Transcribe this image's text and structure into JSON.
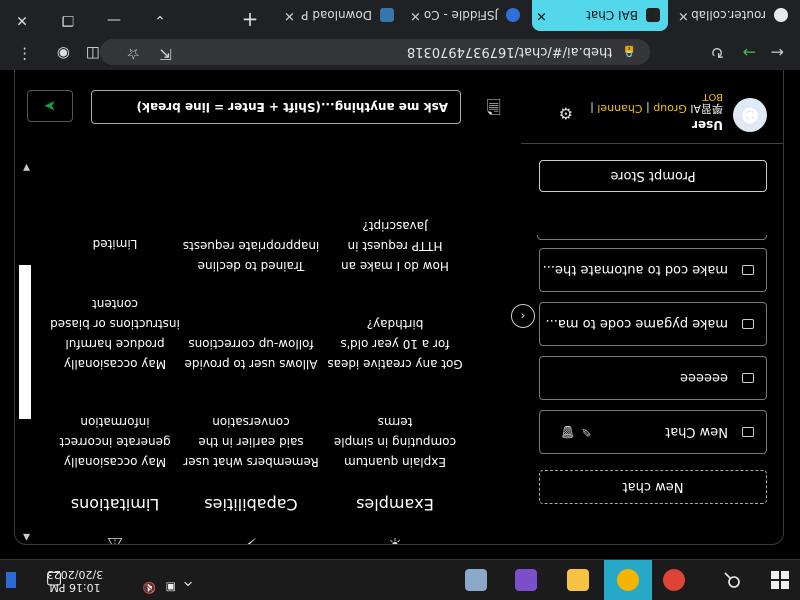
{
  "taskbar": {
    "clock_time": "10:16 PM",
    "clock_date": "3/20/2023",
    "tray_expand": "^",
    "apps": [
      {
        "name": "chrome-icon",
        "color": "#db4437"
      },
      {
        "name": "browser-icon",
        "color": "#f4b400"
      },
      {
        "name": "file-explorer-icon",
        "color": "#f6c243"
      },
      {
        "name": "visual-studio-icon",
        "color": "#7b4fc9"
      },
      {
        "name": "app-icon",
        "color": "#8aa9c8"
      }
    ]
  },
  "sidebar": {
    "new_chat": "New chat",
    "chats": [
      {
        "label": "New Chat",
        "active": true
      },
      {
        "label": "eeeeee"
      },
      {
        "label": "make pygame code to ma..."
      },
      {
        "label": "make cod to automate the..."
      }
    ],
    "prompt_store": "Prompt Store",
    "user": {
      "name": "User",
      "chinese": "學習AI",
      "group": "Group",
      "separator": "|",
      "channel": "Channel",
      "bot": "BOT"
    }
  },
  "main": {
    "columns": [
      {
        "icon": "sun-icon",
        "title": "Examples",
        "items": [
          "Explain quantum computing in simple terms",
          "Got any creative ideas for a 10 year old's birthday?",
          "How do I make an HTTP request in Javascript?"
        ]
      },
      {
        "icon": "lightning-icon",
        "title": "Capabilities",
        "items": [
          "Remembers what user said earlier in the conversation",
          "Allows user to provide follow-up corrections",
          "Trained to decline inappropriate requests"
        ]
      },
      {
        "icon": "warning-icon",
        "title": "Limitations",
        "items": [
          "May occasionally generate incorrect information",
          "May occasionally produce harmful instructions or biased content",
          "Limited"
        ]
      }
    ],
    "input_placeholder": "Ask me anything...(Shift + Enter = line break)"
  },
  "browser": {
    "url": "theb.ai/#/chat/1679374970318",
    "tabs": [
      {
        "title": "router.collab",
        "color": "#e8e8e8"
      },
      {
        "title": "BAI Chat",
        "color": "#222222",
        "active": true
      },
      {
        "title": "JSFiddle - Co",
        "color": "#2f6fd6"
      },
      {
        "title": "Download P",
        "color": "#3776ab"
      }
    ]
  }
}
